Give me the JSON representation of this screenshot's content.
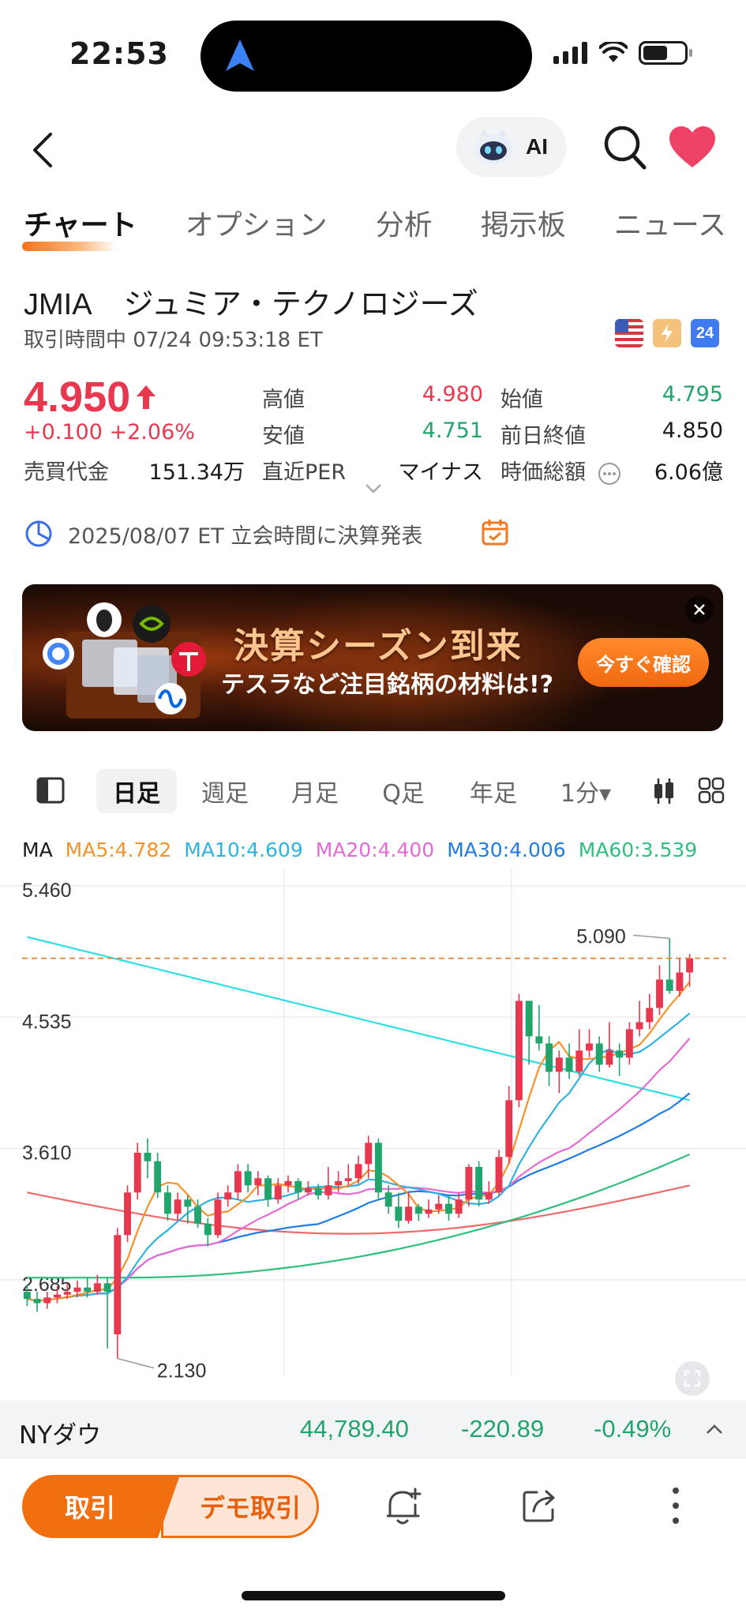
{
  "status_bar": {
    "time": "22:53"
  },
  "nav": {
    "ai_label": "AI"
  },
  "tabs": [
    {
      "label": "チャート",
      "active": true
    },
    {
      "label": "オプション",
      "active": false
    },
    {
      "label": "分析",
      "active": false
    },
    {
      "label": "掲示板",
      "active": false
    },
    {
      "label": "ニュース",
      "active": false
    }
  ],
  "stock": {
    "symbol": "JMIA",
    "name": "ジュミア・テクノロジーズ",
    "trading_status": "取引時間中 07/24 09:53:18 ET",
    "flag_24h": "24",
    "price": "4.950",
    "change": "+0.100 +2.06%",
    "turnover_label": "売買代金",
    "turnover_value": "151.34万",
    "high_label": "高値",
    "high_value": "4.980",
    "low_label": "安値",
    "low_value": "4.751",
    "per_label": "直近PER",
    "per_value": "マイナス",
    "open_label": "始値",
    "open_value": "4.795",
    "prev_close_label": "前日終値",
    "prev_close_value": "4.850",
    "mktcap_label": "時価総額",
    "mktcap_value": "6.06億"
  },
  "earnings": {
    "text": "2025/08/07 ET 立会時間に決算発表"
  },
  "banner": {
    "title": "決算シーズン到来",
    "subtitle": "テスラなど注目銘柄の材料は!?",
    "cta": "今すぐ確認"
  },
  "period_tabs": [
    {
      "label": "日足",
      "active": true
    },
    {
      "label": "週足",
      "active": false
    },
    {
      "label": "月足",
      "active": false
    },
    {
      "label": "Q足",
      "active": false
    },
    {
      "label": "年足",
      "active": false
    },
    {
      "label": "1分▾",
      "active": false
    }
  ],
  "ma_legend": [
    {
      "label": "MA",
      "color": "#1a1a1a"
    },
    {
      "label": "MA5:4.782",
      "color": "#f5922a"
    },
    {
      "label": "MA10:4.609",
      "color": "#2fb2e0"
    },
    {
      "label": "MA20:4.400",
      "color": "#e66ad4"
    },
    {
      "label": "MA30:4.006",
      "color": "#1f7be6"
    },
    {
      "label": "MA60:3.539",
      "color": "#2fbe7d"
    }
  ],
  "chart_data": {
    "type": "candlestick",
    "y_tick_labels": [
      "5.460",
      "4.535",
      "3.610",
      "2.685"
    ],
    "ylim": [
      2.05,
      5.46
    ],
    "grid": true,
    "current_price_line": 4.95,
    "max_annotation": {
      "label": "5.090",
      "value": 5.09
    },
    "min_annotation": {
      "label": "2.130",
      "value": 2.13
    },
    "up_color": "#e8384f",
    "down_color": "#22a46d",
    "candles": [
      [
        2.6,
        2.55,
        2.65,
        2.5
      ],
      [
        2.55,
        2.52,
        2.6,
        2.46
      ],
      [
        2.52,
        2.56,
        2.6,
        2.48
      ],
      [
        2.56,
        2.58,
        2.64,
        2.52
      ],
      [
        2.58,
        2.6,
        2.66,
        2.55
      ],
      [
        2.6,
        2.63,
        2.68,
        2.56
      ],
      [
        2.63,
        2.6,
        2.7,
        2.56
      ],
      [
        2.6,
        2.66,
        2.72,
        2.58
      ],
      [
        2.66,
        2.6,
        2.7,
        2.2
      ],
      [
        2.3,
        3.0,
        3.05,
        2.13
      ],
      [
        3.0,
        3.3,
        3.35,
        2.95
      ],
      [
        3.3,
        3.58,
        3.65,
        3.25
      ],
      [
        3.58,
        3.52,
        3.68,
        3.4
      ],
      [
        3.52,
        3.3,
        3.58,
        3.26
      ],
      [
        3.3,
        3.15,
        3.35,
        3.1
      ],
      [
        3.15,
        3.25,
        3.3,
        3.1
      ],
      [
        3.25,
        3.2,
        3.28,
        3.08
      ],
      [
        3.2,
        3.08,
        3.25,
        3.05
      ],
      [
        3.08,
        3.0,
        3.12,
        2.92
      ],
      [
        3.0,
        3.25,
        3.3,
        2.98
      ],
      [
        3.25,
        3.3,
        3.35,
        3.2
      ],
      [
        3.3,
        3.45,
        3.5,
        3.25
      ],
      [
        3.45,
        3.35,
        3.5,
        3.3
      ],
      [
        3.35,
        3.4,
        3.45,
        3.28
      ],
      [
        3.4,
        3.25,
        3.42,
        3.2
      ],
      [
        3.25,
        3.35,
        3.4,
        3.22
      ],
      [
        3.35,
        3.38,
        3.42,
        3.3
      ],
      [
        3.38,
        3.3,
        3.4,
        3.25
      ],
      [
        3.3,
        3.33,
        3.38,
        3.28
      ],
      [
        3.33,
        3.28,
        3.36,
        3.25
      ],
      [
        3.28,
        3.35,
        3.48,
        3.25
      ],
      [
        3.35,
        3.38,
        3.45,
        3.3
      ],
      [
        3.38,
        3.4,
        3.5,
        3.35
      ],
      [
        3.4,
        3.5,
        3.56,
        3.36
      ],
      [
        3.5,
        3.65,
        3.7,
        3.4
      ],
      [
        3.65,
        3.3,
        3.68,
        3.25
      ],
      [
        3.3,
        3.2,
        3.35,
        3.15
      ],
      [
        3.2,
        3.1,
        3.3,
        3.05
      ],
      [
        3.1,
        3.2,
        3.3,
        3.08
      ],
      [
        3.2,
        3.15,
        3.22,
        3.1
      ],
      [
        3.15,
        3.18,
        3.25,
        3.12
      ],
      [
        3.18,
        3.22,
        3.28,
        3.15
      ],
      [
        3.22,
        3.15,
        3.28,
        3.1
      ],
      [
        3.15,
        3.25,
        3.3,
        3.12
      ],
      [
        3.25,
        3.48,
        3.5,
        3.2
      ],
      [
        3.48,
        3.25,
        3.52,
        3.2
      ],
      [
        3.25,
        3.3,
        3.38,
        3.22
      ],
      [
        3.3,
        3.55,
        3.6,
        3.28
      ],
      [
        3.55,
        3.95,
        4.05,
        3.5
      ],
      [
        3.95,
        4.65,
        4.7,
        3.9
      ],
      [
        4.65,
        4.4,
        4.65,
        4.2
      ],
      [
        4.4,
        4.35,
        4.62,
        4.3
      ],
      [
        4.35,
        4.15,
        4.4,
        4.05
      ],
      [
        4.15,
        4.25,
        4.3,
        4.0
      ],
      [
        4.25,
        4.15,
        4.35,
        4.1
      ],
      [
        4.15,
        4.3,
        4.45,
        4.12
      ],
      [
        4.3,
        4.35,
        4.45,
        4.25
      ],
      [
        4.35,
        4.2,
        4.4,
        4.15
      ],
      [
        4.2,
        4.3,
        4.5,
        4.18
      ],
      [
        4.3,
        4.25,
        4.35,
        4.12
      ],
      [
        4.25,
        4.45,
        4.5,
        4.2
      ],
      [
        4.45,
        4.5,
        4.65,
        4.4
      ],
      [
        4.5,
        4.6,
        4.7,
        4.45
      ],
      [
        4.6,
        4.8,
        4.9,
        4.55
      ],
      [
        4.8,
        4.72,
        5.09,
        4.7
      ],
      [
        4.72,
        4.85,
        4.95,
        4.68
      ],
      [
        4.85,
        4.95,
        4.98,
        4.75
      ]
    ]
  },
  "index": {
    "name": "NYダウ",
    "value": "44,789.40",
    "change": "-220.89",
    "pct": "-0.49%"
  },
  "actions": {
    "trade": "取引",
    "demo": "デモ取引"
  }
}
